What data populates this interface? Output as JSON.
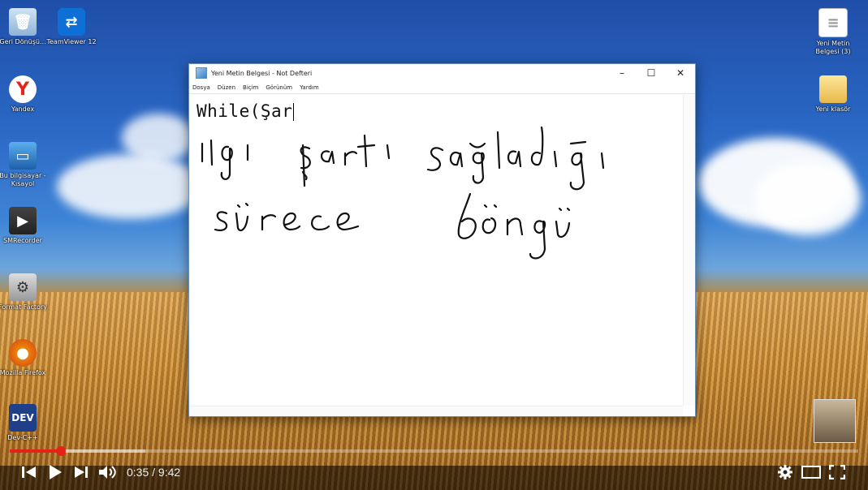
{
  "desktop": {
    "icons_left": [
      {
        "label": "Geri Dönüşü...",
        "icon": "recycle-bin-icon"
      },
      {
        "label": "TeamViewer 12",
        "icon": "teamviewer-icon"
      },
      {
        "label": "Yandex",
        "icon": "yandex-icon"
      },
      {
        "label": "Bu bilgisayar - Kısayol",
        "icon": "computer-icon"
      },
      {
        "label": "SMRecorder",
        "icon": "recorder-icon"
      },
      {
        "label": "Format Factory",
        "icon": "format-factory-icon"
      },
      {
        "label": "Mozilla Firefox",
        "icon": "firefox-icon"
      },
      {
        "label": "Dev-C++",
        "icon": "devcpp-icon"
      }
    ],
    "icons_right": [
      {
        "label": "Yeni Metin Belgesi (3)",
        "icon": "text-document-icon"
      },
      {
        "label": "Yeni klasör",
        "icon": "folder-icon"
      }
    ]
  },
  "notepad": {
    "title": "Yeni Metin Belgesi - Not Defteri",
    "menu": [
      "Dosya",
      "Düzen",
      "Biçim",
      "Görünüm",
      "Yardım"
    ],
    "typed_text": "While(Şar",
    "handwriting": [
      "ilgi şartı sağladığı",
      "sürece döngü"
    ]
  },
  "player": {
    "current_time": "0:35",
    "separator": "/",
    "duration": "9:42",
    "progress_fraction": 0.06,
    "buffered_fraction": 0.16,
    "accent": "#e62117"
  }
}
